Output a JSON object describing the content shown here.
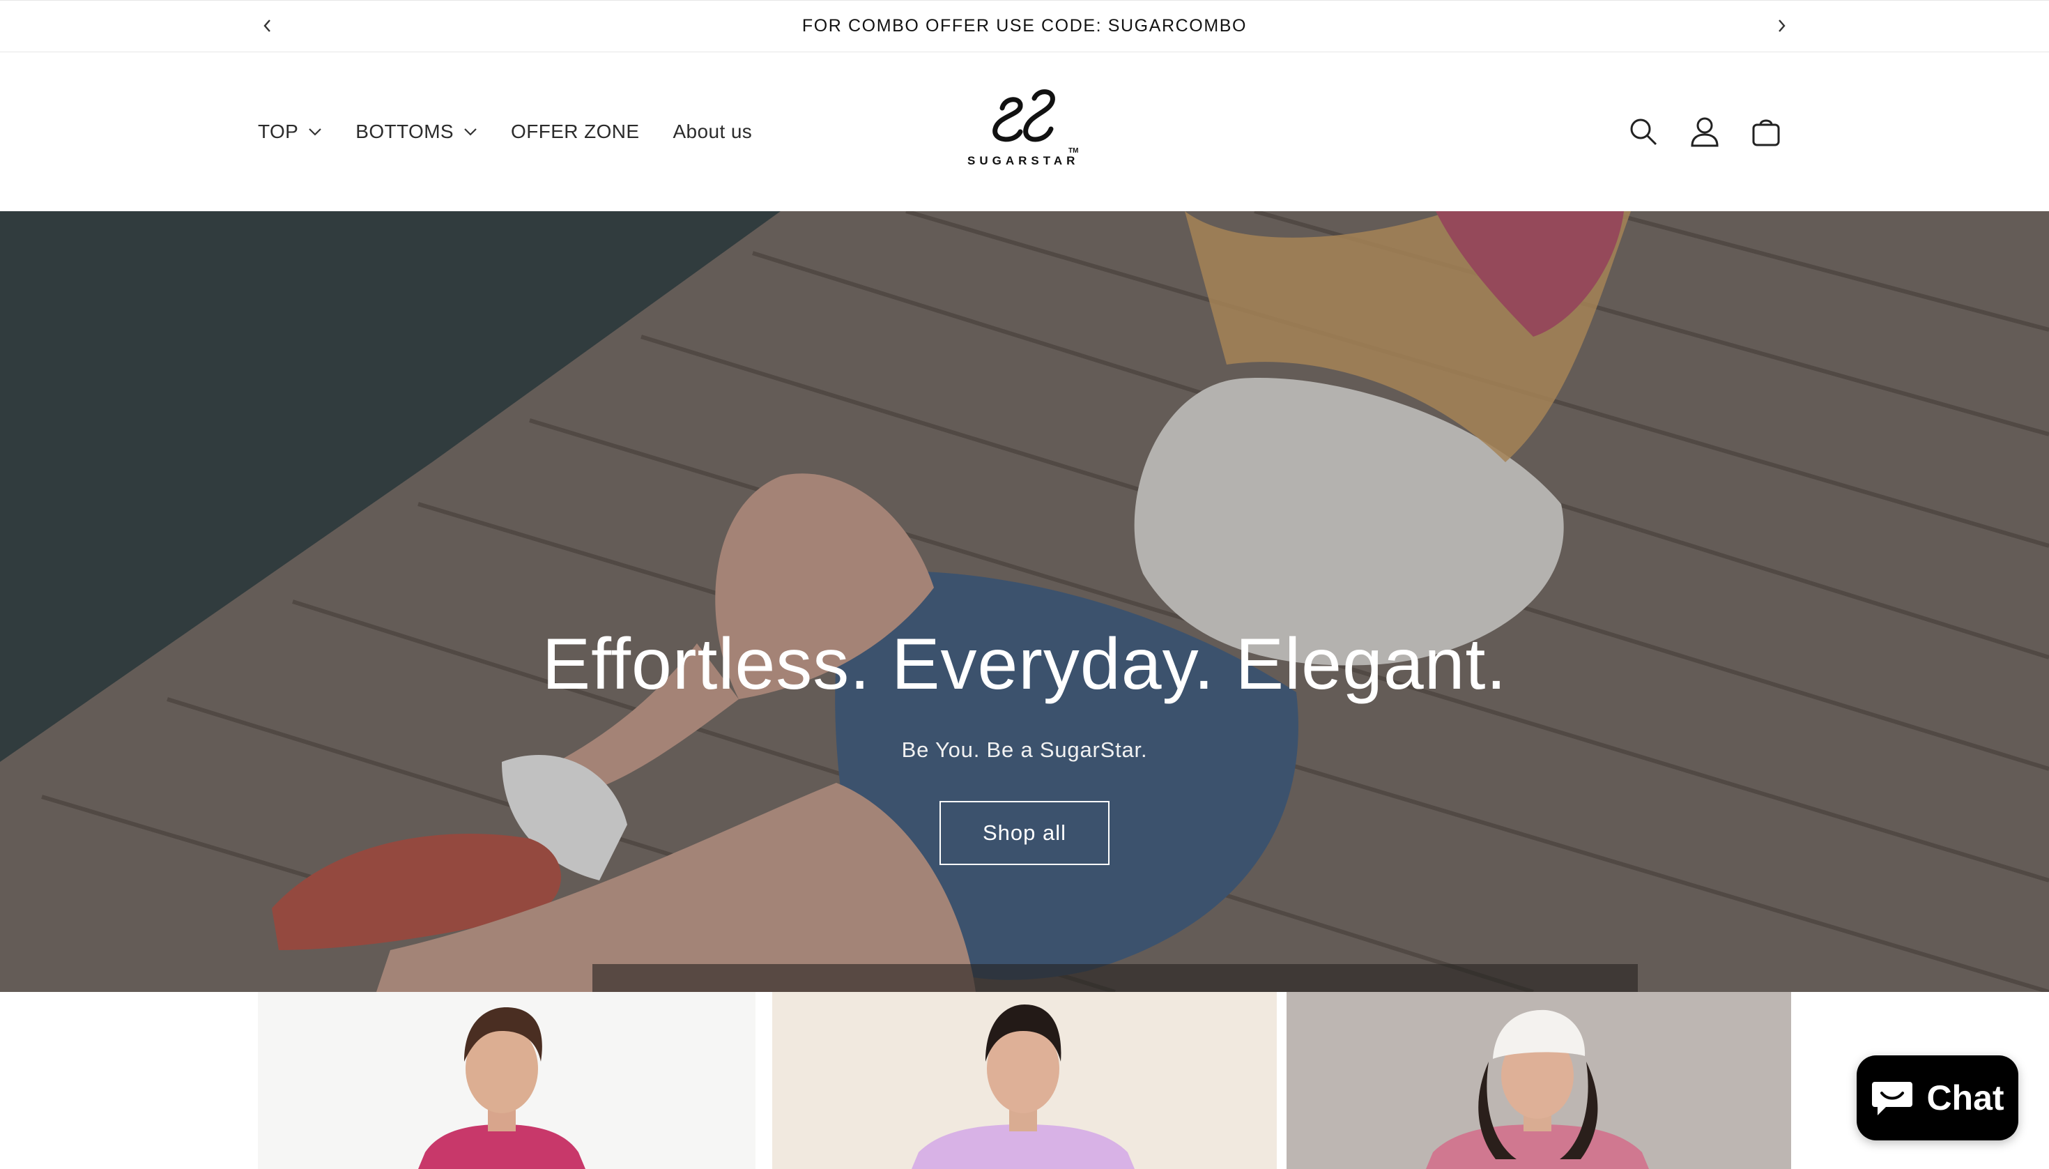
{
  "announcement": {
    "text": "FOR COMBO OFFER USE CODE: SUGARCOMBO",
    "prev_icon": "chevron-left-icon",
    "next_icon": "chevron-right-icon"
  },
  "nav": {
    "items": [
      {
        "label": "TOP",
        "has_dropdown": true
      },
      {
        "label": "BOTTOMS",
        "has_dropdown": true
      },
      {
        "label": "OFFER ZONE",
        "has_dropdown": false
      },
      {
        "label": "About us",
        "has_dropdown": false
      }
    ]
  },
  "brand": {
    "logo_text": "SUGARSTAR",
    "trademark": "TM"
  },
  "header_icons": [
    "search-icon",
    "account-icon",
    "cart-icon"
  ],
  "hero": {
    "heading": "Effortless. Everyday. Elegant.",
    "subheading": "Be You. Be a SugarStar.",
    "button_label": "Shop all"
  },
  "product_cards": [
    {
      "shirt_color": "#c8386a",
      "background": "#f6f6f5"
    },
    {
      "shirt_color": "#d8b2e6",
      "background": "#f1e9df"
    },
    {
      "shirt_color": "#d07890",
      "background": "#bdb6b2"
    }
  ],
  "chat": {
    "label": "Chat",
    "icon": "chat-bubble-icon"
  },
  "colors": {
    "text": "#121212",
    "chat_bg": "#000000",
    "hero_text": "#ffffff"
  }
}
